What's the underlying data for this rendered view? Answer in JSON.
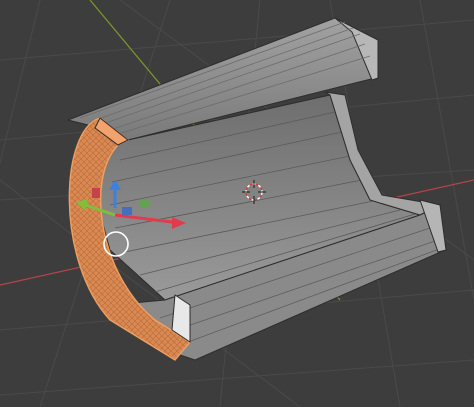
{
  "viewport": {
    "background_color": "#3d3d3d",
    "grid_color": "#4a4a4a",
    "x_axis_color": "#b5444a",
    "y_axis_color": "#7a9a2a",
    "selection_color": "#e8874a",
    "mesh_face_color": "#8f8f8f",
    "mesh_edge_color": "#2d2d2d"
  },
  "scene": {
    "object_shape": "open-half-pipe-mesh",
    "icons": [
      "3d-cursor-icon",
      "move-gizmo-icon",
      "object-origin-circle-icon"
    ]
  },
  "gizmo": {
    "x_color": "#e03c4e",
    "y_color": "#7fbf3a",
    "z_color": "#3a82e0"
  }
}
